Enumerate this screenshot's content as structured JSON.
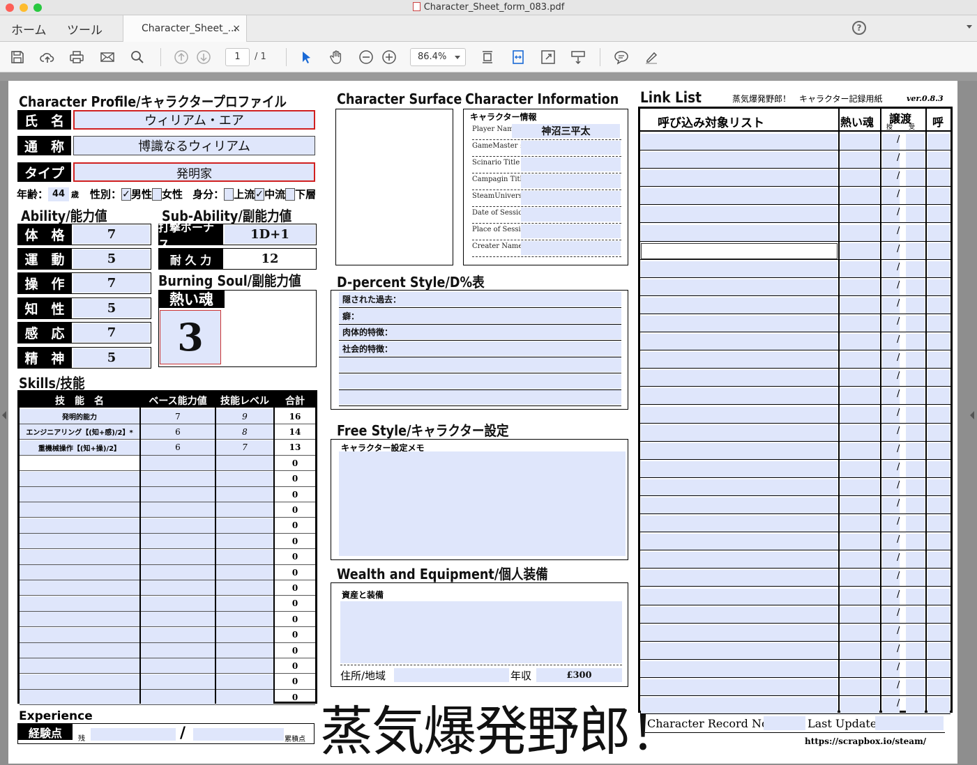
{
  "window": {
    "title": "Character_Sheet_form_083.pdf"
  },
  "nav": {
    "home": "ホーム",
    "tools": "ツール",
    "tab_label": "Character_Sheet_...",
    "tab_close": "×",
    "help": "?"
  },
  "toolbar": {
    "page_current": "1",
    "page_total": "/ 1",
    "zoom": "86.4%"
  },
  "sheet": {
    "profile_title": "Character Profile/キャラクタープロファイル",
    "name_label": "氏　名",
    "name_value": "ウィリアム・エア",
    "alias_label": "通　称",
    "alias_value": "博識なるウィリアム",
    "type_label": "タイプ",
    "type_value": "発明家",
    "age_label": "年齢：",
    "age_value": "44",
    "age_unit": "歳",
    "gender_label": "性別：",
    "gender_male_check": "✓",
    "gender_male": "男性",
    "gender_female": "女性",
    "status_label": "身分：",
    "status_upper": "上流",
    "status_middle_check": "✓",
    "status_middle": "中流",
    "status_lower": "下層",
    "ability_title": "Ability/能力値",
    "abilities": [
      {
        "label": "体　格",
        "value": "7"
      },
      {
        "label": "運　動",
        "value": "5"
      },
      {
        "label": "操　作",
        "value": "7"
      },
      {
        "label": "知　性",
        "value": "5"
      },
      {
        "label": "感　応",
        "value": "7"
      },
      {
        "label": "精　神",
        "value": "5"
      }
    ],
    "subability_title": "Sub-Ability/副能力値",
    "sub_abilities": [
      {
        "label": "打撃ボーナス",
        "value": "1D+1"
      },
      {
        "label": "耐 久 力",
        "value": "12"
      }
    ],
    "burning_title": "Burning Soul/副能力値",
    "hot_soul_label": "熱い魂",
    "hot_soul_value": "3",
    "skills_title": "Skills/技能",
    "skills_headers": [
      "技　能　名",
      "ベース能力値",
      "技能レベル",
      "合計"
    ],
    "skills": [
      {
        "name": "発明的能力",
        "base": "7",
        "level": "9",
        "total": "16"
      },
      {
        "name": "エンジニアリング【(知+感)/2】*",
        "base": "6",
        "level": "8",
        "total": "14"
      },
      {
        "name": "重機械操作【(知+操)/2】",
        "base": "6",
        "level": "7",
        "total": "13"
      },
      {
        "name": "",
        "base": "",
        "level": "",
        "total": "0"
      },
      {
        "name": "",
        "base": "",
        "level": "",
        "total": "0"
      },
      {
        "name": "",
        "base": "",
        "level": "",
        "total": "0"
      },
      {
        "name": "",
        "base": "",
        "level": "",
        "total": "0"
      },
      {
        "name": "",
        "base": "",
        "level": "",
        "total": "0"
      },
      {
        "name": "",
        "base": "",
        "level": "",
        "total": "0"
      },
      {
        "name": "",
        "base": "",
        "level": "",
        "total": "0"
      },
      {
        "name": "",
        "base": "",
        "level": "",
        "total": "0"
      },
      {
        "name": "",
        "base": "",
        "level": "",
        "total": "0"
      },
      {
        "name": "",
        "base": "",
        "level": "",
        "total": "0"
      },
      {
        "name": "",
        "base": "",
        "level": "",
        "total": "0"
      },
      {
        "name": "",
        "base": "",
        "level": "",
        "total": "0"
      },
      {
        "name": "",
        "base": "",
        "level": "",
        "total": "0"
      },
      {
        "name": "",
        "base": "",
        "level": "",
        "total": "0"
      },
      {
        "name": "",
        "base": "",
        "level": "",
        "total": "0"
      },
      {
        "name": "",
        "base": "",
        "level": "",
        "total": "0"
      }
    ],
    "experience_title": "Experience",
    "exp_label": "経験点",
    "exp_remaining": "残",
    "exp_slash": "/",
    "exp_total": "累積点",
    "surface_title": "Character Surface",
    "info_title": "Character Information",
    "info_header": "キャラクター情報",
    "info_fields": [
      {
        "label": "Player Name :",
        "value": "神沼三平太"
      },
      {
        "label": "GameMaster :",
        "value": ""
      },
      {
        "label": "Scinario Title :",
        "value": ""
      },
      {
        "label": "Campagin Title :",
        "value": ""
      },
      {
        "label": "SteamUniverse:",
        "value": ""
      },
      {
        "label": "Date of Session:",
        "value": ""
      },
      {
        "label": "Place of Session:",
        "value": ""
      },
      {
        "label": "Creater Name :",
        "value": ""
      }
    ],
    "dpercent_title": "D-percent Style/D%表",
    "dpercent_fields": [
      "隠された過去：",
      "癖：",
      "肉体的特徴：",
      "社会的特徴：",
      "",
      "",
      ""
    ],
    "free_title": "Free Style/キャラクター設定",
    "free_memo": "キャラクター設定メモ",
    "wealth_title": "Wealth and Equipment/個人装備",
    "wealth_header": "資産と装備",
    "address_label": "住所/地域",
    "income_label": "年収",
    "income_value": "£300",
    "logo_text": "蒸気爆発野郎！",
    "link_title": "Link List",
    "game_title": "蒸気爆発野郎！　キャラクター記録用紙",
    "version": "ver.0.8.3",
    "link_headers": {
      "target": "呼び込み対象リスト",
      "hot": "熱い魂",
      "transfer": "譲渡",
      "give": "授",
      "receive": "受",
      "call": "呼"
    },
    "link_slash": "/",
    "record_label": "Character Record No.",
    "last_update_label": "Last Update:",
    "url": "https://scrapbox.io/steam/"
  }
}
